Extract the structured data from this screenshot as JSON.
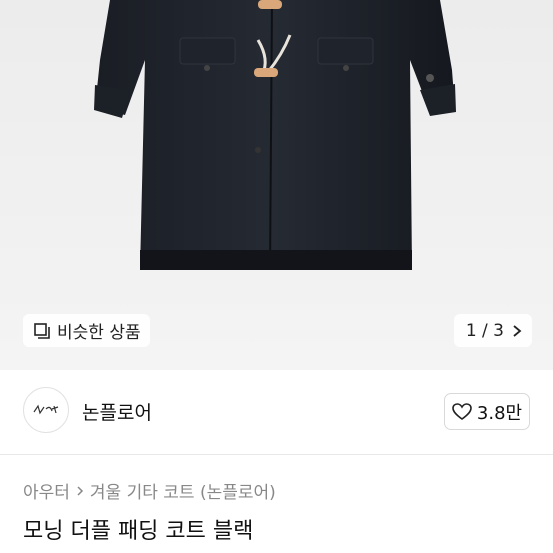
{
  "product_image": {
    "similar_label": "비슷한 상품",
    "pager_text": "1 / 3"
  },
  "seller": {
    "name": "논플로어",
    "like_count": "3.8만"
  },
  "breadcrumb": {
    "items": [
      "아우터",
      "겨울 기타 코트 (논플로어)"
    ]
  },
  "product": {
    "title": "모닝 더플 패딩 코트 블랙"
  },
  "icons": [
    "similar-icon",
    "chevron-right-icon",
    "heart-icon",
    "chevron-right-icon"
  ]
}
